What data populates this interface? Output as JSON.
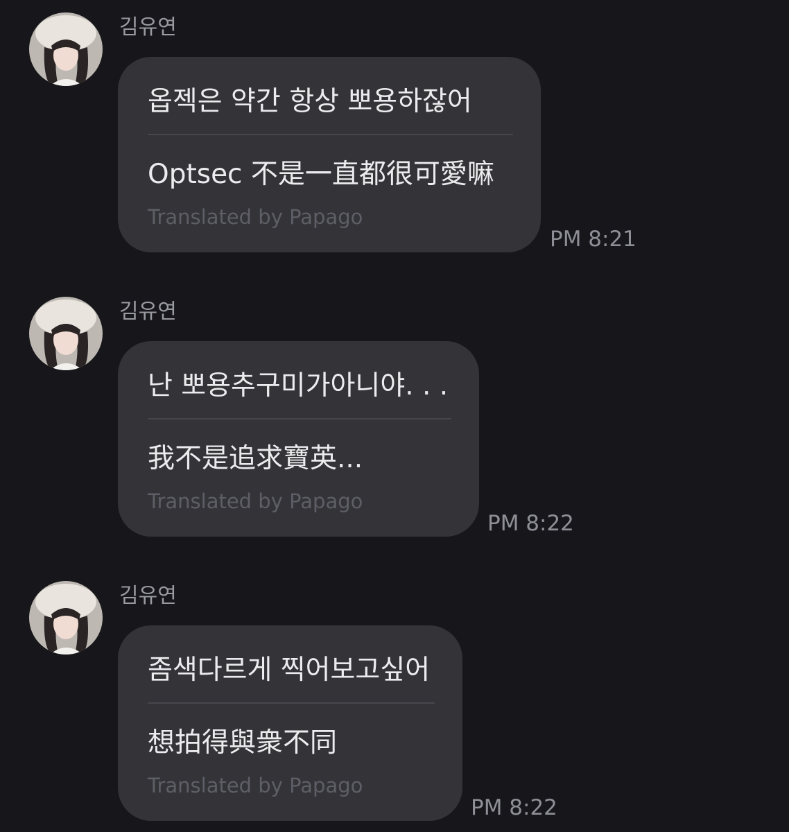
{
  "messages": [
    {
      "sender": "김유연",
      "original": "옵젝은 약간 항상 뽀용하잖어",
      "translated": "Optsec 不是一直都很可愛嘛",
      "credit": "Translated by Papago",
      "time": "PM 8:21"
    },
    {
      "sender": "김유연",
      "original": "난 뽀용추구미가아니야. . .",
      "translated": "我不是追求寶英...",
      "credit": "Translated by Papago",
      "time": "PM 8:22"
    },
    {
      "sender": "김유연",
      "original": "좀색다르게 찍어보고싶어",
      "translated": "想拍得與衆不同",
      "credit": "Translated by Papago",
      "time": "PM 8:22"
    }
  ],
  "colors": {
    "background": "#17171b",
    "bubble": "#333338",
    "text": "#ececee",
    "sender": "#9a9aa2",
    "credit": "#5e5e66",
    "time": "#8f8f97"
  }
}
